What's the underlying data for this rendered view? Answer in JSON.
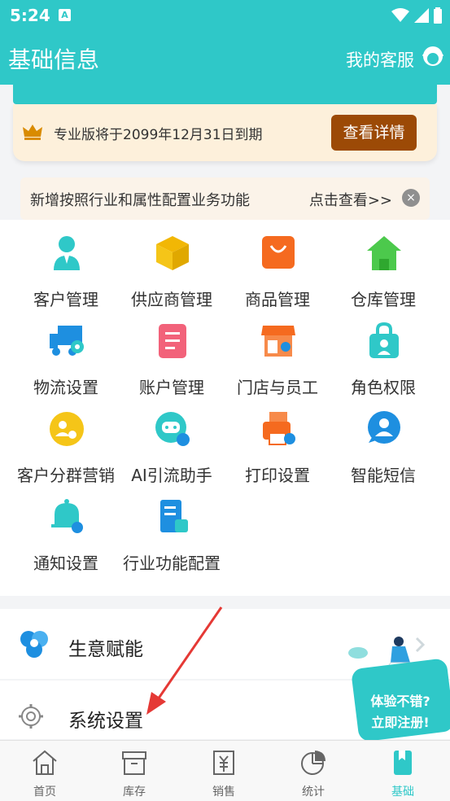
{
  "status": {
    "time": "5:24",
    "ime": "A"
  },
  "header": {
    "title": "基础信息",
    "service": "我的客服"
  },
  "pro": {
    "text": "专业版将于2099年12月31日到期",
    "button": "查看详情"
  },
  "notice": {
    "text": "新增按照行业和属性配置业务功能",
    "link": "点击查看>>",
    "close": "×"
  },
  "grid": [
    {
      "label": "客户管理",
      "icon": "customer-icon"
    },
    {
      "label": "供应商管理",
      "icon": "supplier-icon"
    },
    {
      "label": "商品管理",
      "icon": "goods-icon"
    },
    {
      "label": "仓库管理",
      "icon": "warehouse-icon"
    },
    {
      "label": "物流设置",
      "icon": "logistics-icon"
    },
    {
      "label": "账户管理",
      "icon": "account-icon"
    },
    {
      "label": "门店与员工",
      "icon": "store-icon"
    },
    {
      "label": "角色权限",
      "icon": "role-icon"
    },
    {
      "label": "客户分群营销",
      "icon": "group-marketing-icon"
    },
    {
      "label": "AI引流助手",
      "icon": "ai-assistant-icon"
    },
    {
      "label": "打印设置",
      "icon": "print-icon"
    },
    {
      "label": "智能短信",
      "icon": "sms-icon"
    },
    {
      "label": "通知设置",
      "icon": "notification-icon"
    },
    {
      "label": "行业功能配置",
      "icon": "industry-config-icon"
    }
  ],
  "rows": {
    "business": "生意赋能",
    "settings": "系统设置"
  },
  "promo": {
    "line1": "体验不错?",
    "line2": "立即注册!"
  },
  "tabs": [
    {
      "label": "首页",
      "icon": "home-icon"
    },
    {
      "label": "库存",
      "icon": "inventory-icon"
    },
    {
      "label": "销售",
      "icon": "sales-icon"
    },
    {
      "label": "统计",
      "icon": "stats-icon"
    },
    {
      "label": "基础",
      "icon": "basic-icon"
    }
  ],
  "colors": {
    "accent": "#2fc8c8",
    "pro_button": "#9c4a06",
    "arrow": "#e53935"
  }
}
